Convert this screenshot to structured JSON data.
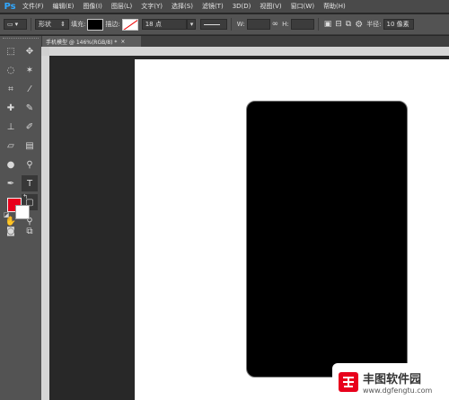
{
  "app": {
    "logo": "Ps",
    "colors": {
      "accent": "#31a8ff",
      "fg_swatch": "#e8001c",
      "bg_swatch": "#ffffff"
    }
  },
  "menu": [
    "文件(F)",
    "编辑(E)",
    "图像(I)",
    "图层(L)",
    "文字(Y)",
    "选择(S)",
    "滤镜(T)",
    "3D(D)",
    "视图(V)",
    "窗口(W)",
    "帮助(H)"
  ],
  "options": {
    "shape_mode": "形状",
    "fill_label": "填充:",
    "stroke_label": "描边:",
    "stroke_size": "18 点",
    "w_label": "W:",
    "h_label": "H:",
    "radius_label": "半径:",
    "radius_value": "10 像素"
  },
  "document": {
    "tab_title": "手机模型 @ 146%(RGB/8) *",
    "close": "×"
  },
  "watermark": {
    "title": "丰图软件园",
    "url": "www.dgfengtu.com"
  }
}
